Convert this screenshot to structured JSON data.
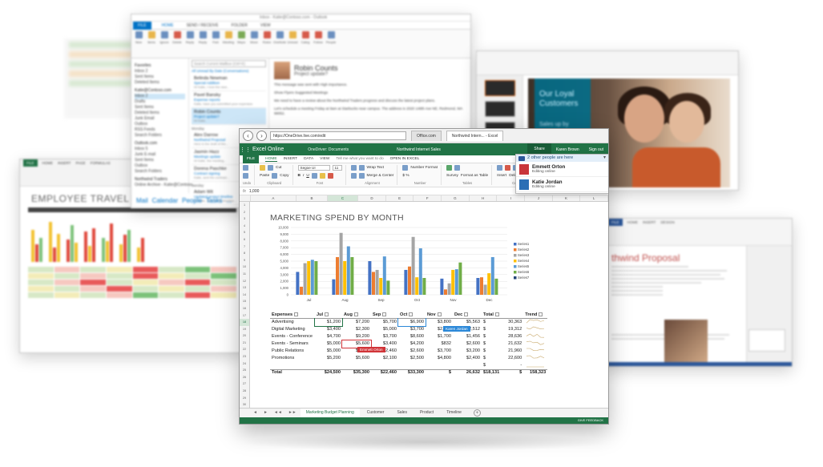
{
  "outlook": {
    "title": "Inbox - Katie@Contoso.com - Outlook",
    "tabs": [
      "FILE",
      "HOME",
      "SEND / RECEIVE",
      "FOLDER",
      "VIEW"
    ],
    "search_placeholder": "Search Current Mailbox (Ctrl+E)",
    "filter_all": "All",
    "filter_unread": "Unread",
    "filter_sort": "By Date (Conversations)",
    "nav": [
      {
        "label": "Favorites",
        "group": true
      },
      {
        "label": "Inbox 2"
      },
      {
        "label": "Sent Items"
      },
      {
        "label": "Deleted Items"
      },
      {
        "label": "Katie@Contoso.com",
        "group": true
      },
      {
        "label": "Inbox 2",
        "selected": true
      },
      {
        "label": "Drafts"
      },
      {
        "label": "Sent Items"
      },
      {
        "label": "Deleted Items"
      },
      {
        "label": "Junk Email"
      },
      {
        "label": "Outbox"
      },
      {
        "label": "RSS Feeds"
      },
      {
        "label": "Search Folders"
      },
      {
        "label": "Outlook.com",
        "group": true
      },
      {
        "label": "Inbox 5"
      },
      {
        "label": "Junk E-mail"
      },
      {
        "label": "Sent Items"
      },
      {
        "label": "Outbox"
      },
      {
        "label": "Search Folders"
      },
      {
        "label": "Northwind Traders",
        "group": true
      },
      {
        "label": "Online Archive - Katie@Contoso..."
      }
    ],
    "messages": [
      {
        "from": "Belinda Newman",
        "subject": "Special Addition",
        "preview": "Hi Katie, I love the new..."
      },
      {
        "from": "Pavel Bansky",
        "subject": "Expense reports",
        "preview": "Katie, have you submitted your expenses"
      },
      {
        "from": "Robin Counts",
        "subject": "Project update?",
        "preview": "Hi Katie,",
        "selected": true
      },
      {
        "day": "Monday"
      },
      {
        "from": "Alex Darrow",
        "subject": "Northwind Proposal",
        "preview": "Here is the draft of the..."
      },
      {
        "from": "Jasmin Hazz",
        "subject": "Meetings update",
        "preview": "Hi Katie, the meeting..."
      },
      {
        "from": "Dorena Paschke",
        "subject": "Contract signing",
        "preview": "Katie, sent the contract..."
      },
      {
        "day": "Sunday"
      },
      {
        "from": "Adam Wit",
        "subject": "Updated project timeline",
        "preview": "Hi Katie, here is the timeline..."
      }
    ],
    "reading": {
      "from": "Robin Counts",
      "subject": "Project update?",
      "importance": "This message was sent with High importance.",
      "links": [
        "Show Flyers",
        "Suggested Meetings"
      ],
      "body1": "We need to have a review about the Northwind Traders progress and discuss the latest project plans.",
      "body2": "Let's schedule a meeting Friday at 9am at Starbucks near campus. The address is 2020 148th Ave NE, Redmond, WA 98052."
    },
    "bottom_nav": [
      "Mail",
      "Calendar",
      "People",
      "Tasks",
      "..."
    ]
  },
  "left_excel": {
    "title": "EMPLOYEE TRAVEL EXPENSE TRENDS"
  },
  "ppt": {
    "slide_title": "Our Loyal Customers",
    "slide_sub": "Sales up by"
  },
  "word": {
    "heading": "thwind Proposal"
  },
  "excel": {
    "url": "https://OneDrive.live.com/edit",
    "browser_tabs": [
      "Office.com",
      "Northwind Intern... - Excel"
    ],
    "app_name": "Excel Online",
    "breadcrumb": "OneDriver: Documents",
    "doc_name": "Northwind Internet Sales",
    "share": "Share",
    "user": "Karen Brown",
    "sign_out": "Sign out",
    "menu": [
      "FILE",
      "HOME",
      "INSERT",
      "DATA",
      "VIEW"
    ],
    "tell_me": "Tell me what you want to do",
    "open_in": "OPEN IN EXCEL",
    "ribbon": {
      "undo": "Undo",
      "cut": "Cut",
      "copy": "Copy",
      "paste": "Paste",
      "clipboard": "Clipboard",
      "font_name": "Segoe UI",
      "font_size": "11",
      "font": "Font",
      "wrap_text": "Wrap Text",
      "merge_center": "Merge & Center",
      "alignment": "Alignment",
      "number_format": "Number Format",
      "number": "Number",
      "survey": "Survey",
      "format_as_table": "Format as Table",
      "tables": "Tables",
      "insert": "Insert",
      "delete": "Delete",
      "format": "Format",
      "cells": "Cells",
      "autosum": "AutoSum",
      "clear": "Clear",
      "editing": "Editing"
    },
    "formula_value": "1,000",
    "columns": [
      "A",
      "B",
      "C",
      "D",
      "E",
      "F",
      "G",
      "H",
      "I",
      "J",
      "K",
      "L"
    ],
    "rows": [
      "1",
      "2",
      "3",
      "4",
      "5",
      "6",
      "7",
      "8",
      "9",
      "10",
      "11",
      "12",
      "13",
      "14",
      "15",
      "16",
      "17",
      "18",
      "19",
      "20",
      "21",
      "22",
      "23",
      "24",
      "25",
      "26",
      "27",
      "28",
      "29",
      "30"
    ],
    "chart_title": "MARKETING SPEND BY MONTH",
    "table": {
      "headers": [
        "Expenses",
        "Jul",
        "Aug",
        "Sep",
        "Oct",
        "Nov",
        "Dec",
        "Total",
        "Trend"
      ],
      "rows": [
        [
          "Advertising",
          "$1,200",
          "$7,200",
          "$5,700",
          "$6,900",
          "$3,800",
          "$5,563",
          "$",
          "30,363"
        ],
        [
          "Digital Marketing",
          "$3,400",
          "$2,300",
          "$5,000",
          "$3,700",
          "$2,400",
          "$2,512",
          "$",
          "19,312"
        ],
        [
          "Events - Conference",
          "$4,700",
          "$9,200",
          "$3,700",
          "$8,600",
          "$1,700",
          "$1,456",
          "$",
          "28,636"
        ],
        [
          "Events - Seminars",
          "$5,000",
          "$5,600",
          "$3,400",
          "$4,200",
          "$832",
          "$2,600",
          "$",
          "21,632"
        ],
        [
          "Public Relations",
          "$5,000",
          "$5,000",
          "$2,460",
          "$2,600",
          "$3,700",
          "$3,200",
          "$",
          "21,960"
        ],
        [
          "Promotions",
          "$5,200",
          "$5,600",
          "$2,100",
          "$2,500",
          "$4,800",
          "$2,400",
          "$",
          "22,600"
        ],
        [
          "",
          "",
          "",
          "",
          "",
          "",
          "",
          "$",
          "-"
        ]
      ],
      "total": [
        "Total",
        "$24,500",
        "$35,300",
        "$22,460",
        "$33,300",
        "$",
        "26,632",
        "$18,131",
        "$",
        "158,323"
      ]
    },
    "collab_red": "Emmett Orton",
    "collab_blue": "Karen Jordan",
    "presence_header": "2 other people are here",
    "presence": [
      {
        "name": "Emmett Orton",
        "status": "Editing online",
        "color": "#c9353a"
      },
      {
        "name": "Katie Jordan",
        "status": "Editing online",
        "color": "#2b6fb5"
      }
    ],
    "sheet_nav": [
      "◄",
      "►",
      "◄◄",
      "►►"
    ],
    "sheets": [
      "Marketing Budget Planning",
      "Customer",
      "Sales",
      "Product",
      "Timeline"
    ],
    "add_sheet": "+",
    "status": "GIVE FEEDBACK",
    "accent": "#217346"
  },
  "chart_data": {
    "type": "bar",
    "title": "MARKETING SPEND BY MONTH",
    "categories": [
      "Jul",
      "Aug",
      "Sep",
      "Oct",
      "Nov",
      "Dec"
    ],
    "ylim": [
      0,
      10000
    ],
    "yticks": [
      "0",
      "1,000",
      "2,000",
      "3,000",
      "4,000",
      "5,000",
      "6,000",
      "7,000",
      "8,000",
      "9,000",
      "10,000"
    ],
    "series": [
      {
        "name": "Series1",
        "color": "#4472c4",
        "values": [
          3400,
          2300,
          5000,
          3700,
          2400,
          2500
        ]
      },
      {
        "name": "Series2",
        "color": "#ed7d31",
        "values": [
          1200,
          5600,
          3400,
          4200,
          800,
          2600
        ]
      },
      {
        "name": "Series3",
        "color": "#a5a5a5",
        "values": [
          4700,
          9200,
          3700,
          8600,
          1700,
          1500
        ]
      },
      {
        "name": "Series4",
        "color": "#ffc000",
        "values": [
          5000,
          5000,
          2500,
          2600,
          3700,
          3200
        ]
      },
      {
        "name": "Series5",
        "color": "#5b9bd5",
        "values": [
          5200,
          7200,
          5700,
          6900,
          3800,
          5600
        ]
      },
      {
        "name": "Series6",
        "color": "#70ad47",
        "values": [
          5000,
          5600,
          2100,
          2500,
          4800,
          2400
        ]
      },
      {
        "name": "Series7",
        "color": "#264478",
        "values": [
          0,
          0,
          0,
          0,
          0,
          0
        ]
      }
    ],
    "legend": "right"
  }
}
